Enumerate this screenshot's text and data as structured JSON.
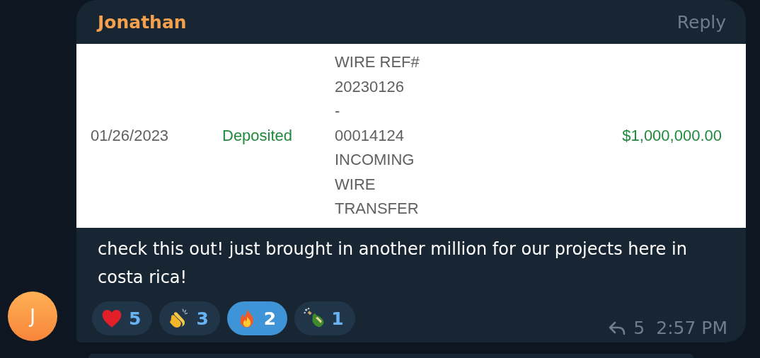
{
  "message": {
    "sender": "Jonathan",
    "reply_label": "Reply",
    "avatar_initial": "J",
    "attachment": {
      "date": "01/26/2023",
      "status": "Deposited",
      "description_lines": [
        "WIRE REF#",
        "20230126",
        "-",
        "00014124",
        "INCOMING",
        "WIRE",
        "TRANSFER"
      ],
      "amount": "$1,000,000.00"
    },
    "text": "check this out! just brought in another million for our projects here in costa rica!",
    "reactions": [
      {
        "kind": "heart",
        "count": "5",
        "selected": false
      },
      {
        "kind": "clap",
        "count": "3",
        "selected": false
      },
      {
        "kind": "fire",
        "count": "2",
        "selected": true
      },
      {
        "kind": "champagne",
        "count": "1",
        "selected": false
      }
    ],
    "replies": "5",
    "time": "2:57 PM"
  }
}
